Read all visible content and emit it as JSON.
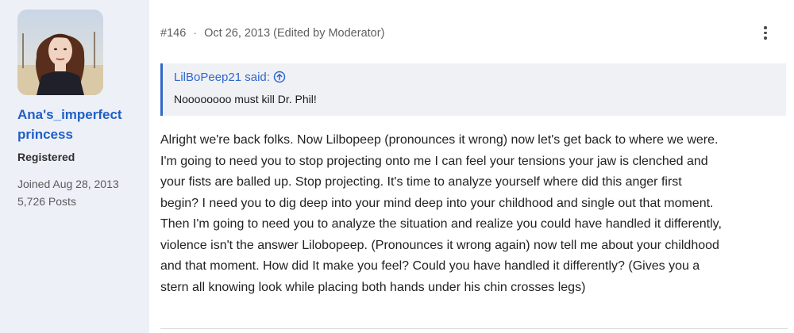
{
  "user": {
    "avatar_alt": "user avatar",
    "name": "Ana's_imperfect princess",
    "title": "Registered",
    "joined": "Joined Aug 28, 2013",
    "posts": "5,726 Posts"
  },
  "post": {
    "number": "#146",
    "separator": "·",
    "date": "Oct 26, 2013 (Edited by Moderator)",
    "quote": {
      "author": "LilBoPeep21 said:",
      "text": "Noooooooo must kill Dr. Phil!"
    },
    "body_lines": [
      "Alright we're back folks. Now Lilbopeep (pronounces it wrong) now let's get back to where we were.",
      "I'm going to need you to stop projecting onto me I can feel your tensions your jaw is clenched and",
      "your fists are balled up. Stop projecting. It's time to analyze yourself where did this anger first",
      "begin? I need you to dig deep into your mind deep into your childhood and single out that moment.",
      "Then I'm going to need you to analyze the situation and realize you could have handled it differently,",
      "violence isn't the answer Lilobopeep. (Pronounces it wrong again) now tell me about your childhood",
      "and that moment. How did It make you feel? Could you have handled it differently? (Gives you a",
      "stern all knowing look while placing both hands under his chin crosses legs)"
    ]
  },
  "colors": {
    "sidebar_bg": "#eef0f8",
    "link": "#1f5fc4",
    "quote_accent": "#2f67c9",
    "quote_bg": "#f0f1f5"
  }
}
